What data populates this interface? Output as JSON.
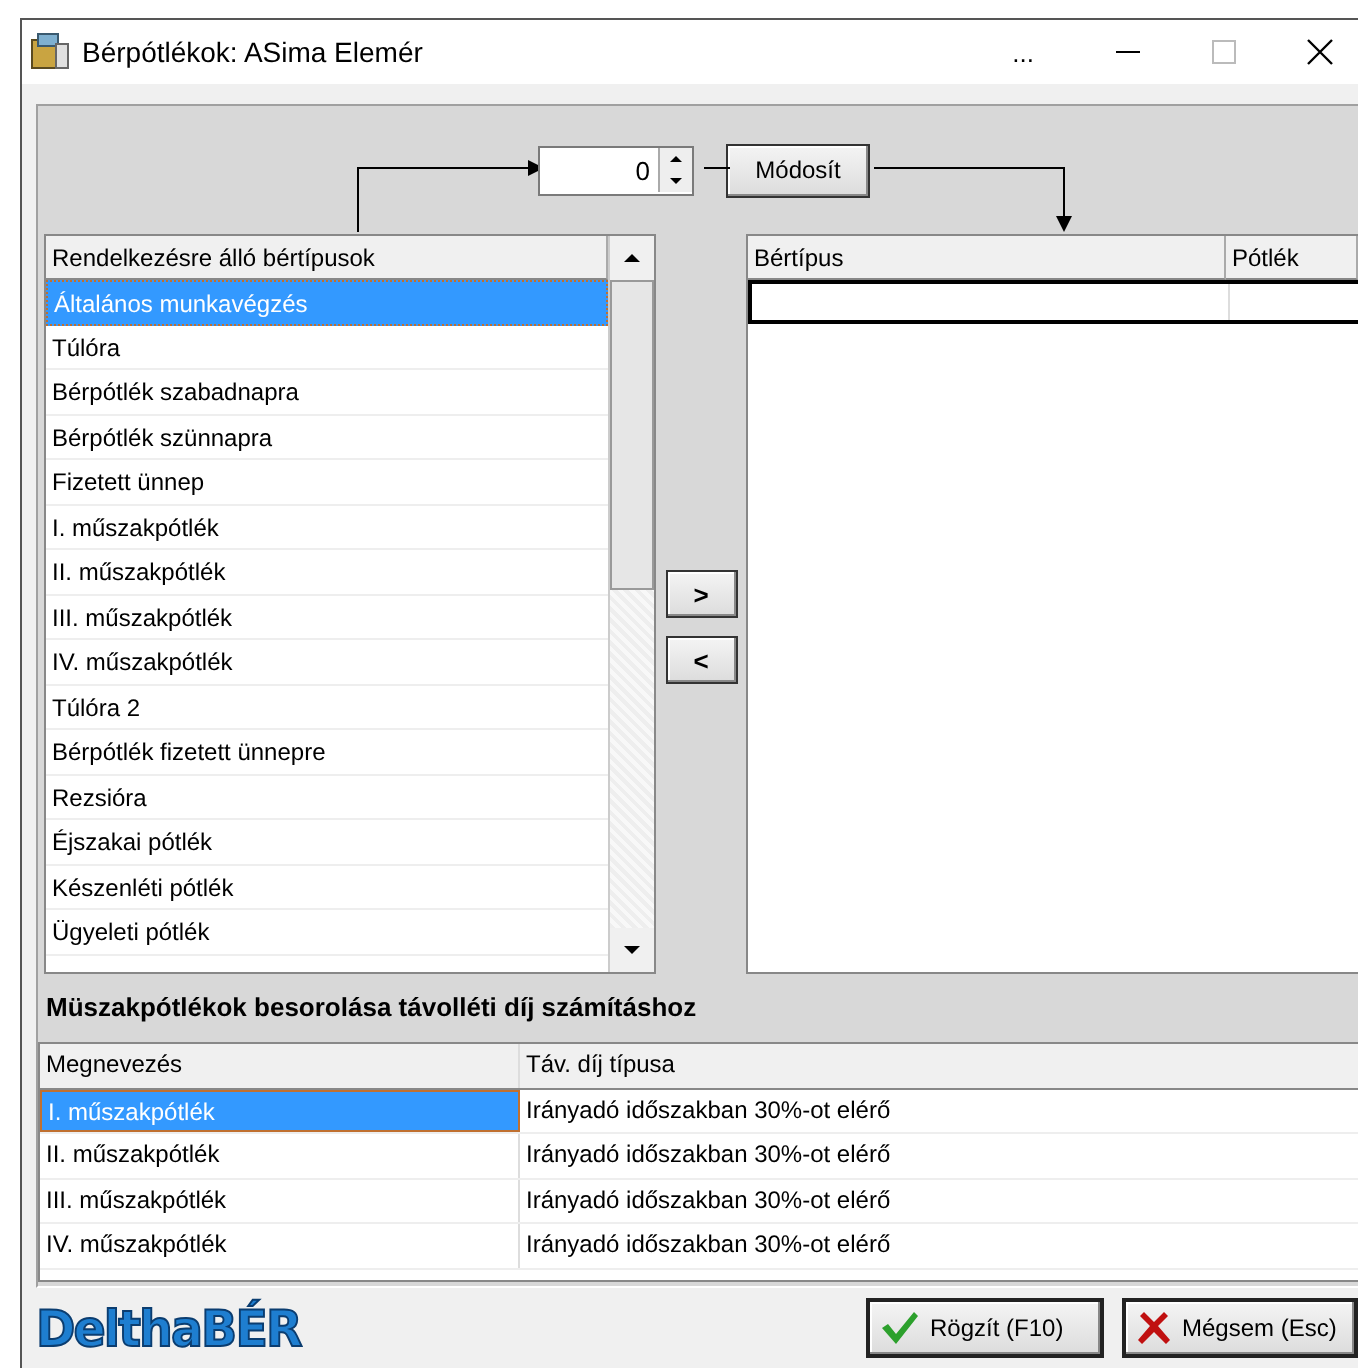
{
  "window": {
    "title": "Bérpótlékok: ASima Elemér",
    "more_button": "..."
  },
  "top_controls": {
    "spin_value": "0",
    "modify_button": "Módosít"
  },
  "available_list": {
    "header": "Rendelkezésre álló bértípusok",
    "items": [
      {
        "label": "Általános munkavégzés",
        "selected": true
      },
      {
        "label": "Túlóra",
        "selected": false
      },
      {
        "label": "Bérpótlék szabadnapra",
        "selected": false
      },
      {
        "label": "Bérpótlék szünnapra",
        "selected": false
      },
      {
        "label": "Fizetett ünnep",
        "selected": false
      },
      {
        "label": "I. műszakpótlék",
        "selected": false
      },
      {
        "label": "II. műszakpótlék",
        "selected": false
      },
      {
        "label": "III. műszakpótlék",
        "selected": false
      },
      {
        "label": "IV. műszakpótlék",
        "selected": false
      },
      {
        "label": "Túlóra 2",
        "selected": false
      },
      {
        "label": "Bérpótlék fizetett ünnepre",
        "selected": false
      },
      {
        "label": "Rezsióra",
        "selected": false
      },
      {
        "label": "Éjszakai pótlék",
        "selected": false
      },
      {
        "label": "Készenléti pótlék",
        "selected": false
      },
      {
        "label": "Ügyeleti pótlék",
        "selected": false
      }
    ]
  },
  "move_buttons": [
    ">",
    "<"
  ],
  "selected_table": {
    "columns": [
      "Bértípus",
      "Pótlék"
    ]
  },
  "shift_section": {
    "title": "Müszakpótlékok besorolása távolléti díj számításhoz",
    "columns": [
      "Megnevezés",
      "Táv. díj típusa"
    ],
    "rows": [
      {
        "name": "I. műszakpótlék",
        "type": "Irányadó időszakban 30%-ot elérő",
        "selected": true
      },
      {
        "name": "II. műszakpótlék",
        "type": "Irányadó időszakban 30%-ot elérő",
        "selected": false
      },
      {
        "name": "III. műszakpótlék",
        "type": "Irányadó időszakban 30%-ot elérő",
        "selected": false
      },
      {
        "name": "IV. műszakpótlék",
        "type": "Irányadó időszakban 30%-ot elérő",
        "selected": false
      }
    ]
  },
  "footer": {
    "logo": "DelthaBÉR",
    "save_button": "Rögzít (F10)",
    "cancel_button": "Mégsem (Esc)"
  }
}
